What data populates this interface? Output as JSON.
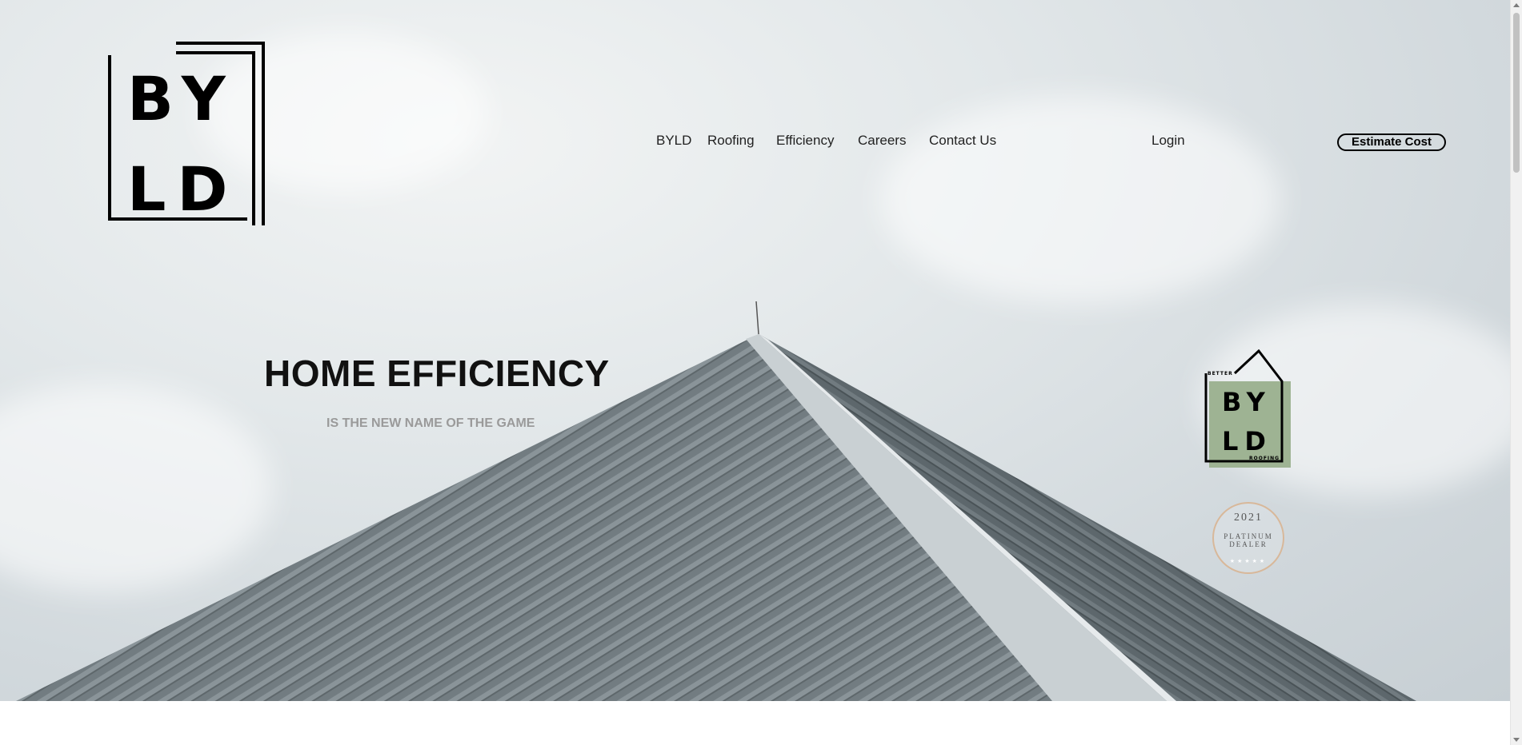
{
  "logo": {
    "row1": "BY",
    "row2": "LD"
  },
  "nav": {
    "items": [
      "BYLD",
      "Roofing",
      "Efficiency",
      "Careers",
      "Contact Us"
    ]
  },
  "header": {
    "login_label": "Login",
    "estimate_label": "Estimate Cost"
  },
  "hero": {
    "title": "HOME EFFICIENCY",
    "subtitle": "IS THE NEW NAME OF THE GAME"
  },
  "badge": {
    "top_text": "BETTER",
    "row1": "BY",
    "row2": "LD",
    "bottom_text": "ROOFING"
  },
  "seal": {
    "year": "2021",
    "line1": "PLATINUM",
    "line2": "DEALER",
    "stars": "★★★★★"
  },
  "colors": {
    "badge_green": "#9eb393",
    "seal_gold": "#d8b89a",
    "roof_gray": "#737d82"
  }
}
